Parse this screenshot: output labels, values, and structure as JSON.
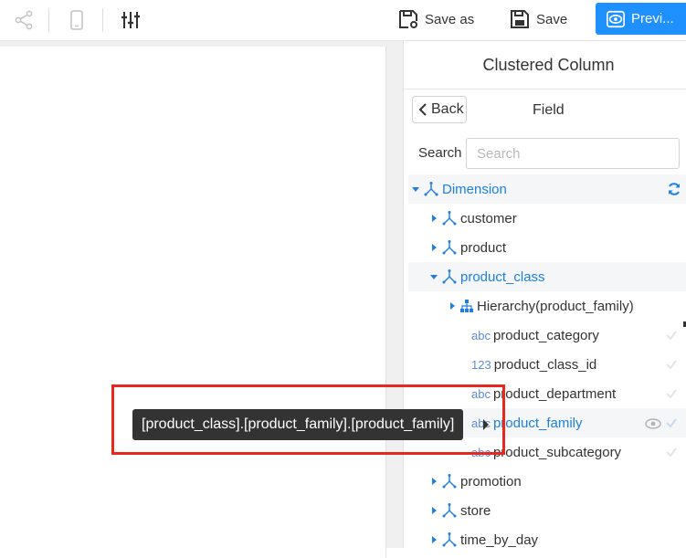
{
  "toolbar": {
    "save_as_label": "Save as",
    "save_label": "Save",
    "preview_label": "Previ..."
  },
  "panel": {
    "title": "Clustered Column",
    "back_label": "Back",
    "field_title": "Field",
    "search_label": "Search",
    "search_placeholder": "Search"
  },
  "tree": {
    "dimension": "Dimension",
    "customer": "customer",
    "product": "product",
    "product_class": "product_class",
    "hierarchy": "Hierarchy(product_family)",
    "fields": [
      {
        "type": "abc",
        "name": "product_category"
      },
      {
        "type": "123",
        "name": "product_class_id"
      },
      {
        "type": "abc",
        "name": "product_department"
      },
      {
        "type": "abc",
        "name": "product_family"
      },
      {
        "type": "abc",
        "name": "product_subcategory"
      }
    ],
    "promotion": "promotion",
    "store": "store",
    "time_by_day": "time_by_day"
  },
  "tooltip": {
    "text": "[product_class].[product_family].[product_family]"
  },
  "colors": {
    "accent": "#1e90ff",
    "link_blue": "#1e7fe0",
    "highlight_border": "#e8281e"
  }
}
